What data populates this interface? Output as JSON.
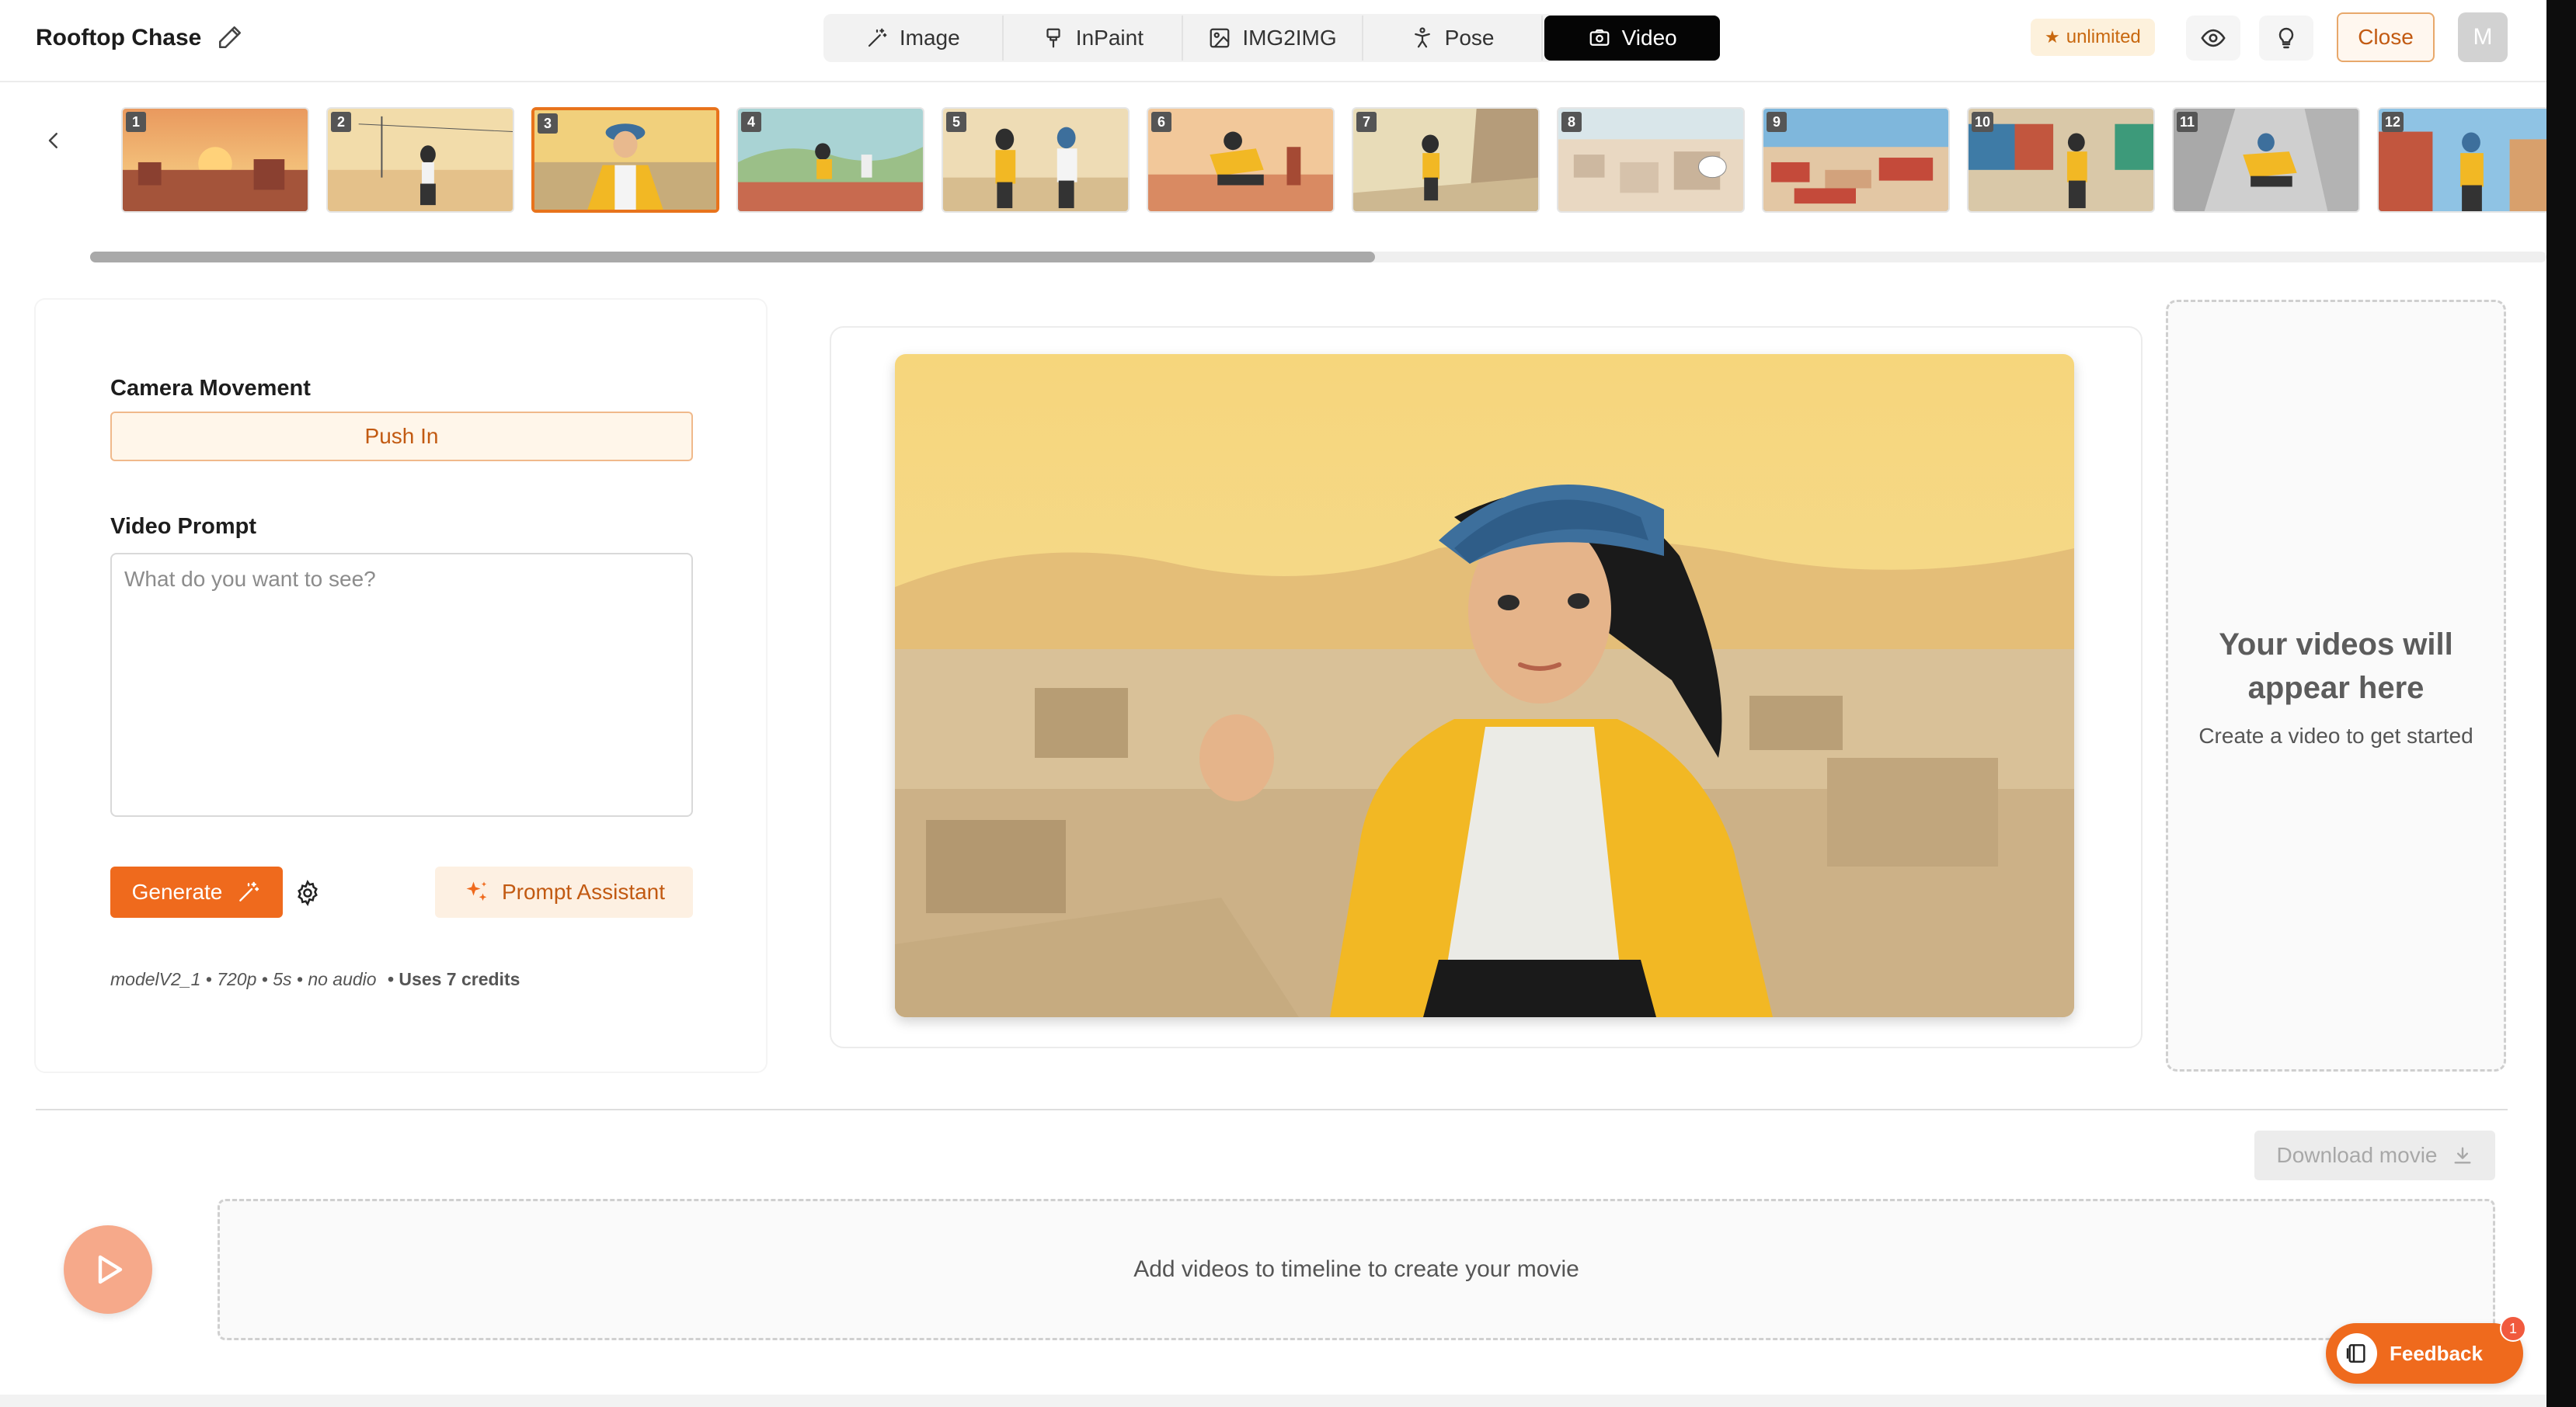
{
  "header": {
    "project_title": "Rooftop Chase",
    "modes": [
      {
        "label": "Image",
        "icon": "wand-icon"
      },
      {
        "label": "InPaint",
        "icon": "brush-icon"
      },
      {
        "label": "IMG2IMG",
        "icon": "image-icon"
      },
      {
        "label": "Pose",
        "icon": "pose-icon"
      },
      {
        "label": "Video",
        "icon": "video-icon",
        "active": true
      }
    ],
    "plan_badge": "unlimited",
    "close_label": "Close",
    "avatar_initial": "M"
  },
  "filmstrip": {
    "selected_index": 3,
    "frames": [
      {
        "number": "1",
        "scene": "sunset over rooftops"
      },
      {
        "number": "2",
        "scene": "girl walking on street"
      },
      {
        "number": "3",
        "scene": "girl in yellow jacket on rooftop"
      },
      {
        "number": "4",
        "scene": "girl running across rooftop"
      },
      {
        "number": "5",
        "scene": "two girls standing"
      },
      {
        "number": "6",
        "scene": "girl jumping over ledge"
      },
      {
        "number": "7",
        "scene": "girl running down alley"
      },
      {
        "number": "8",
        "scene": "city with satellite dish"
      },
      {
        "number": "9",
        "scene": "red-roofed city"
      },
      {
        "number": "10",
        "scene": "girl in market street"
      },
      {
        "number": "11",
        "scene": "girl leaping across street"
      },
      {
        "number": "12",
        "scene": "girl on street"
      }
    ]
  },
  "controls": {
    "camera_movement_label": "Camera Movement",
    "camera_movement_value": "Push In",
    "video_prompt_label": "Video Prompt",
    "video_prompt_placeholder": "What do you want to see?",
    "video_prompt_value": "",
    "generate_label": "Generate",
    "prompt_assistant_label": "Prompt Assistant",
    "model_spec": "modelV2_1 • 720p • 5s • no audio",
    "credits_text": "• Uses 7 credits"
  },
  "videos_panel": {
    "title": "Your videos will appear here",
    "subtitle": "Create a video to get started"
  },
  "timeline": {
    "download_label": "Download movie",
    "empty_text": "Add videos to timeline to create your movie"
  },
  "feedback": {
    "label": "Feedback",
    "count": "1"
  },
  "colors": {
    "accent": "#ef6a1d",
    "accent_soft": "#fdf0e2",
    "active_tab": "#050505"
  }
}
